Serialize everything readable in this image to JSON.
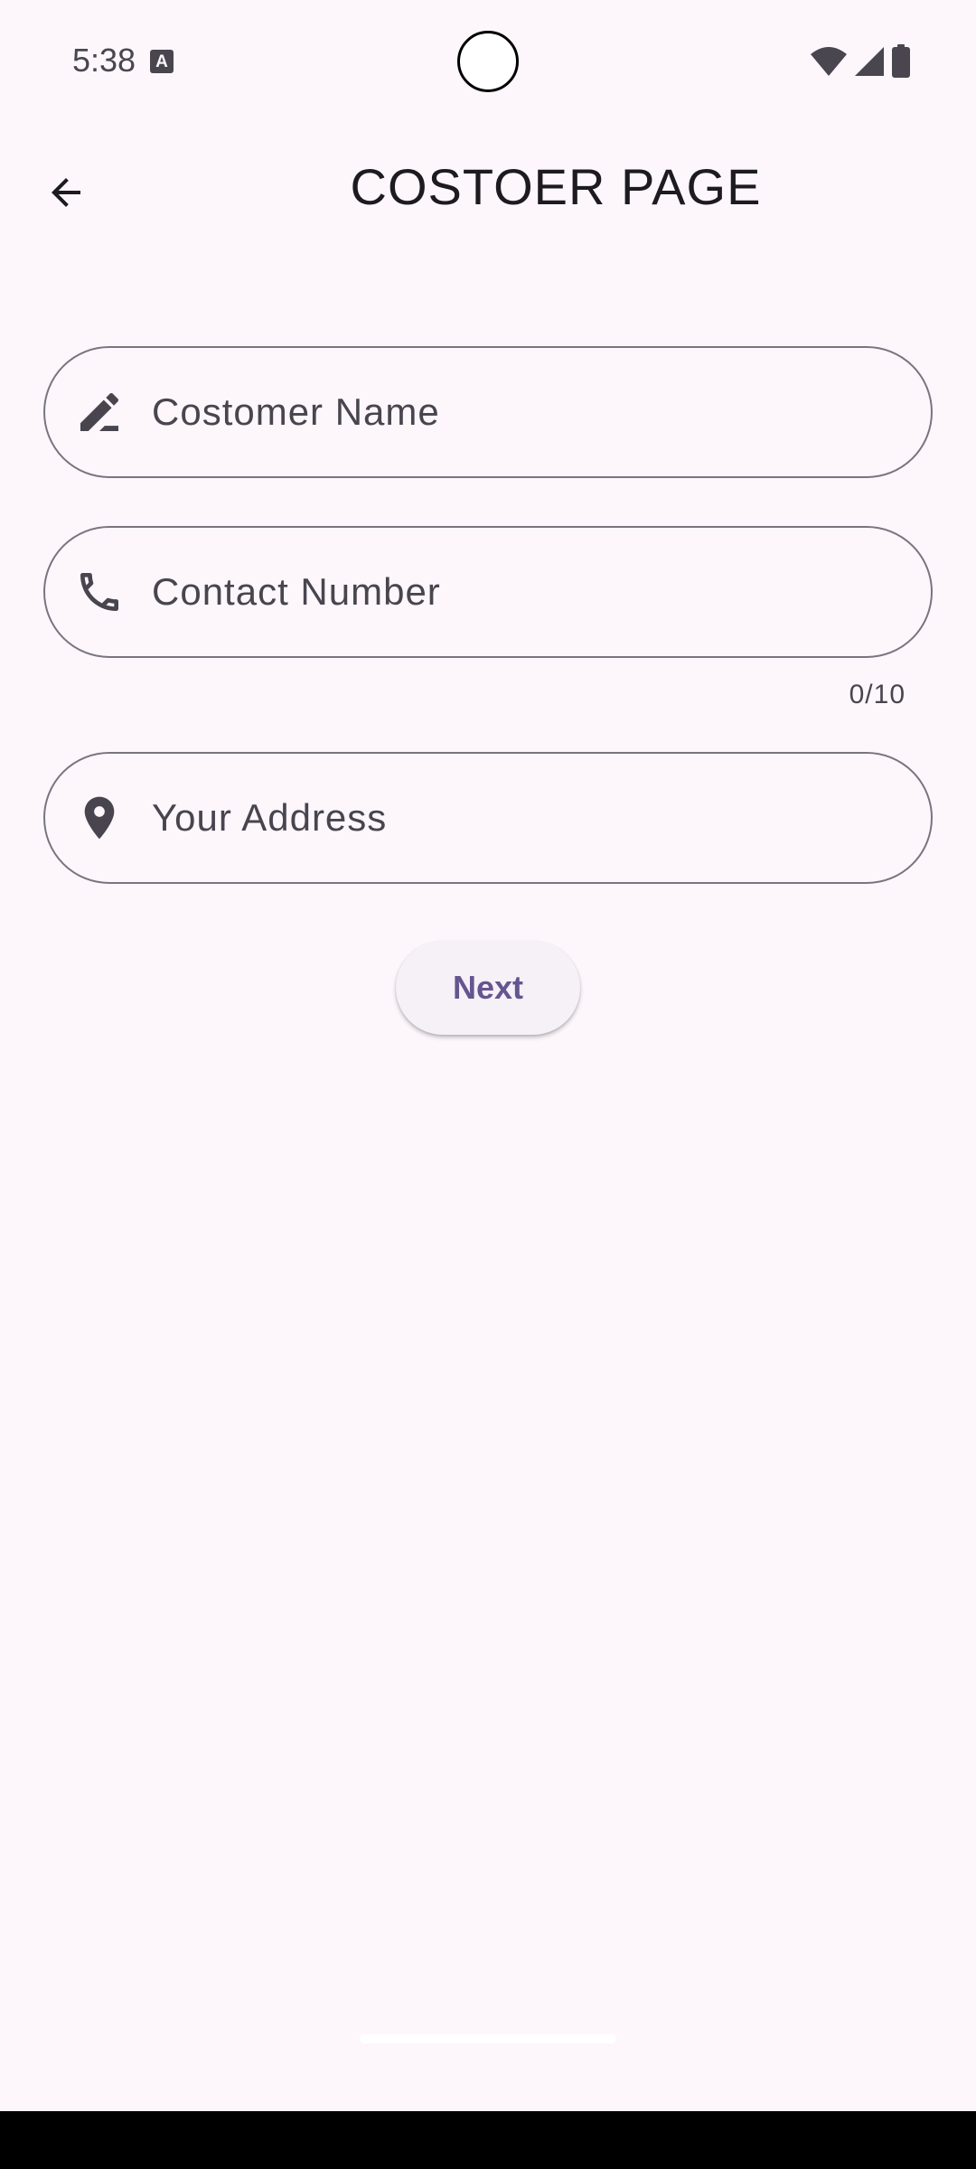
{
  "status_bar": {
    "time": "5:38",
    "keyboard_badge": "A",
    "icons": [
      "wifi-icon",
      "signal-icon",
      "battery-icon"
    ]
  },
  "app_bar": {
    "back_icon": "arrow-back-icon",
    "title": "COSTOER PAGE"
  },
  "form": {
    "customer_name": {
      "placeholder": "Costomer Name",
      "value": "",
      "icon": "edit-icon"
    },
    "contact_number": {
      "placeholder": "Contact Number",
      "value": "",
      "icon": "phone-icon",
      "counter": "0/10"
    },
    "address": {
      "placeholder": "Your Address",
      "value": "",
      "icon": "location-pin-icon"
    },
    "next_label": "Next"
  },
  "colors": {
    "background": "#fdf7fc",
    "outline": "#79747e",
    "icon": "#49454f",
    "primary": "#65558f",
    "button_surface": "#f6f0f7"
  }
}
